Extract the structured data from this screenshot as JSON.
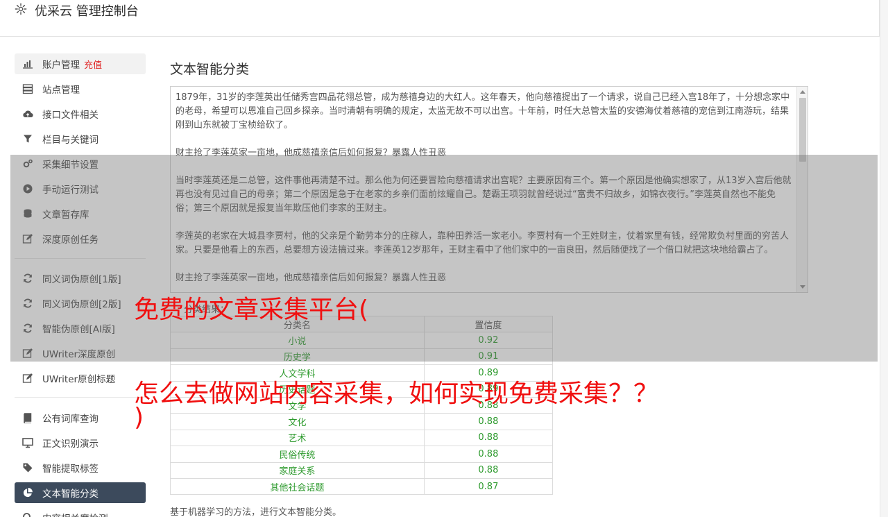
{
  "header": {
    "title": "优采云 管理控制台"
  },
  "sidebar": {
    "items": [
      {
        "label": "账户管理",
        "extra": "充值",
        "icon": "bar-chart-icon"
      },
      {
        "label": "站点管理",
        "icon": "server-icon"
      },
      {
        "label": "接口文件相关",
        "icon": "cloud-upload-icon"
      },
      {
        "label": "栏目与关键词",
        "icon": "filter-icon"
      },
      {
        "label": "采集细节设置",
        "icon": "cogs-icon"
      },
      {
        "label": "手动运行测试",
        "icon": "play-circle-icon"
      },
      {
        "label": "文章暂存库",
        "icon": "database-icon"
      },
      {
        "label": "深度原创任务",
        "icon": "edit-icon"
      },
      {
        "label": "同义词伪原创[1版]",
        "icon": "refresh-icon"
      },
      {
        "label": "同义词伪原创[2版]",
        "icon": "refresh-icon"
      },
      {
        "label": "智能伪原创[AI版]",
        "icon": "refresh-icon"
      },
      {
        "label": "UWriter深度原创",
        "icon": "edit-icon"
      },
      {
        "label": "UWriter原创标题",
        "icon": "edit-icon"
      },
      {
        "label": "公有词库查询",
        "icon": "book-icon"
      },
      {
        "label": "正文识别演示",
        "icon": "desktop-icon"
      },
      {
        "label": "智能提取标签",
        "icon": "tag-icon"
      },
      {
        "label": "文本智能分类",
        "icon": "pie-chart-icon"
      },
      {
        "label": "内容相关度检测",
        "icon": "search-icon"
      }
    ]
  },
  "main": {
    "title": "文本智能分类",
    "textarea": {
      "paragraphs": [
        "1879年，31岁的李莲英出任储秀宫四品花翎总管，成为慈禧身边的大红人。这年春天，他向慈禧提出了一个请求，说自己已经入宫18年了，十分想念家中的老母，希望可以恩准自己回乡探亲。当时清朝有明确的规定，太监无故不可以出宫。十年前，时任大总管太监的安德海仗着慈禧的宠信到江南游玩，结果刚到山东就被丁宝桢给砍了。",
        "财主抢了李莲英家一亩地，他成慈禧亲信后如何报复？暴露人性丑恶",
        "当时李莲英还是二总管，这件事他再清楚不过。那么他为何还要冒险向慈禧请求出宫呢？主要原因有三个。第一个原因是他确实想家了，从13岁入宫后他就再也没有见过自己的母亲；第二个原因是急于在老家的乡亲们面前炫耀自己。楚霸王项羽就曾经说过“富贵不归故乡，如锦衣夜行。”李莲英自然也不能免俗；第三个原因就是报复当年欺压他们李家的王财主。",
        "李莲英的老家在大城县李贾村，他的父亲是个勤劳本分的庄稼人，靠种田养活一家老小。李贾村有一个王姓财主，仗着家里有钱，经常欺负村里面的穷苦人家。只要是他看上的东西，总要想方设法搞过来。李莲英12岁那年，王财主看中了他们家中的一亩良田，然后随便找了一个借口就把这块地给霸占了。",
        "财主抢了李莲英家一亩地，他成慈禧亲信后如何报复？暴露人性丑恶"
      ]
    },
    "result_label": "分类结果：",
    "table": {
      "headers": [
        "分类名",
        "置信度"
      ],
      "rows": [
        [
          "小说",
          "0.92"
        ],
        [
          "历史学",
          "0.91"
        ],
        [
          "人文学科",
          "0.89"
        ],
        [
          "历史话题",
          "0.89"
        ],
        [
          "文学",
          "0.88"
        ],
        [
          "文化",
          "0.88"
        ],
        [
          "艺术",
          "0.88"
        ],
        [
          "民俗传统",
          "0.88"
        ],
        [
          "家庭关系",
          "0.88"
        ],
        [
          "其他社会话题",
          "0.87"
        ]
      ]
    },
    "footer_note": "基于机器学习的方法，进行文本智能分类。"
  },
  "overlay": {
    "line1": "免费的文章采集平台(",
    "line2": "怎么去做网站内容采集，如何实现免费采集？？",
    "line3": ")"
  }
}
